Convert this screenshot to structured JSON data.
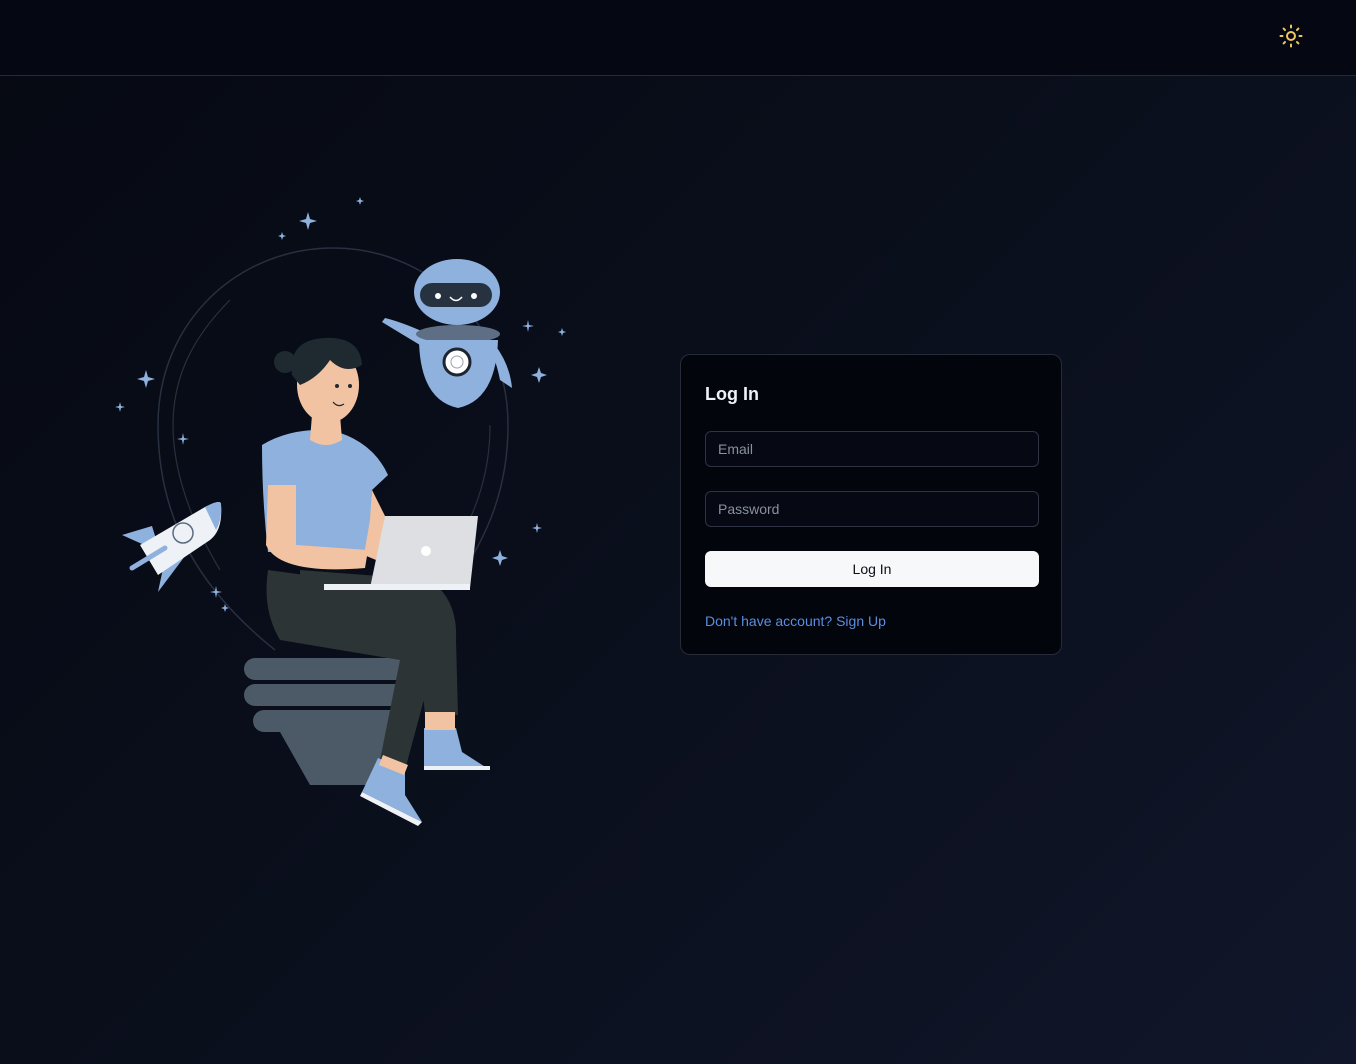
{
  "header": {
    "theme_toggle_icon": "sun-icon",
    "theme_toggle_color": "#f0c75a"
  },
  "illustration": {
    "description_icon": "person-with-laptop-robot-rocket-illustration"
  },
  "login": {
    "title": "Log In",
    "email_placeholder": "Email",
    "email_value": "",
    "password_placeholder": "Password",
    "password_value": "",
    "submit_label": "Log In",
    "signup_link": "Don't have account? Sign Up"
  },
  "colors": {
    "background": "#0a0f1c",
    "card": "#03050d",
    "accent_link": "#5b8de0",
    "illustration_blue": "#8fb1de"
  }
}
